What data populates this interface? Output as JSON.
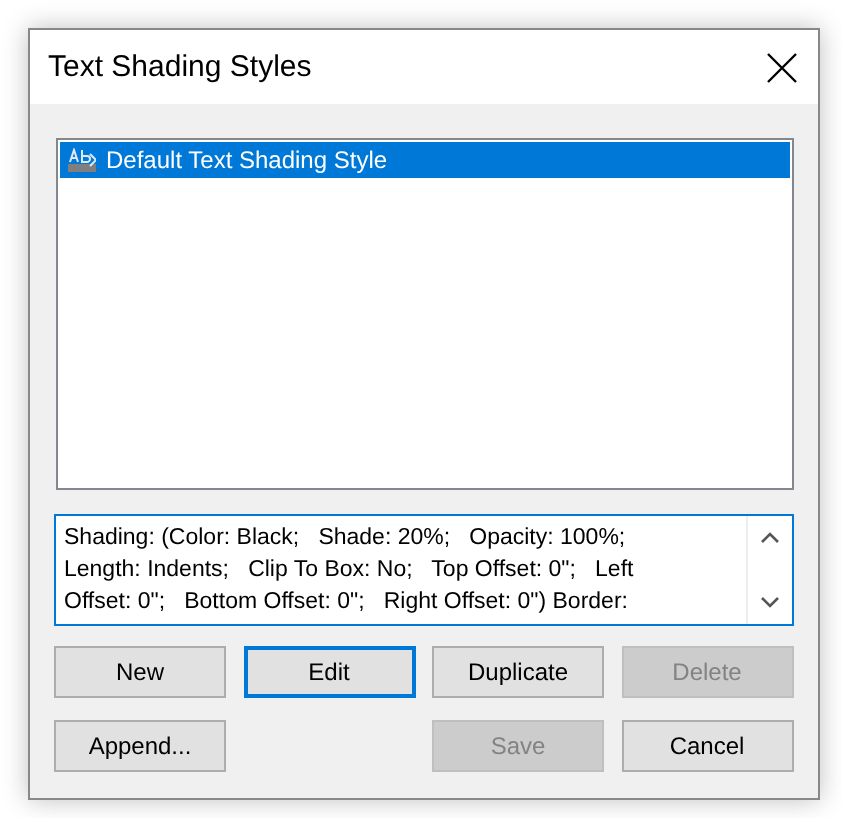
{
  "window": {
    "title": "Text Shading Styles"
  },
  "styles": [
    {
      "label": "Default Text Shading Style",
      "selected": true
    }
  ],
  "description": {
    "lines": [
      "Shading: (Color: Black;   Shade: 20%;   Opacity: 100%;",
      "Length: Indents;   Clip To Box: No;   Top Offset: 0\";   Left",
      "Offset: 0\";   Bottom Offset: 0\";   Right Offset: 0\") Border:"
    ]
  },
  "button_rows": [
    [
      {
        "label": "New",
        "disabled": false,
        "default": false
      },
      {
        "label": "Edit",
        "disabled": false,
        "default": true
      },
      {
        "label": "Duplicate",
        "disabled": false,
        "default": false
      },
      {
        "label": "Delete",
        "disabled": true,
        "default": false
      }
    ],
    [
      {
        "label": "Append...",
        "disabled": false,
        "default": false
      },
      {
        "label": "Save",
        "disabled": true,
        "default": false
      },
      {
        "label": "Cancel",
        "disabled": false,
        "default": false
      }
    ]
  ]
}
